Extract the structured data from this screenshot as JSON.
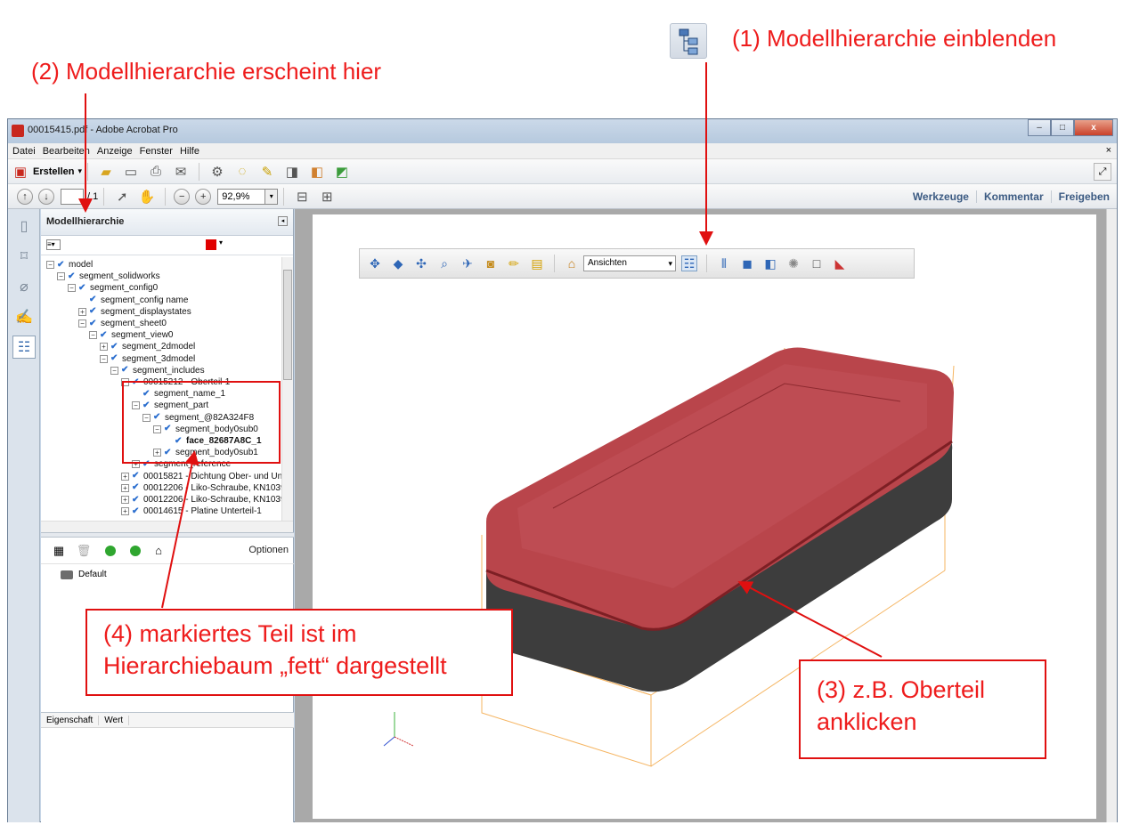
{
  "annotations": {
    "step1": "(1) Modellhierarchie einblenden",
    "step2": "(2) Modellhierarchie erscheint hier",
    "step3_line1": "(3) z.B. Oberteil",
    "step3_line2": "anklicken",
    "step4_line1": "(4) markiertes Teil ist im",
    "step4_line2": "Hierarchiebaum „fett“ dargestellt"
  },
  "window": {
    "title": "00015415.pdf - Adobe Acrobat Pro",
    "min": "–",
    "max": "□",
    "close": "x"
  },
  "menu": [
    "Datei",
    "Bearbeiten",
    "Anzeige",
    "Fenster",
    "Hilfe"
  ],
  "menu_close": "×",
  "toolbar": {
    "create_label": "Erstellen",
    "page_total": "/ 1",
    "zoom": "92,9%",
    "tools": "Werkzeuge",
    "comment": "Kommentar",
    "share": "Freigeben"
  },
  "panel": {
    "title": "Modellhierarchie",
    "color": "#e00000",
    "tree": [
      {
        "label": "model",
        "level": 0,
        "exp": "−",
        "bold": false
      },
      {
        "label": "segment_solidworks",
        "level": 1,
        "exp": "−",
        "bold": false
      },
      {
        "label": "segment_config0",
        "level": 2,
        "exp": "−",
        "bold": false
      },
      {
        "label": "segment_config name",
        "level": 3,
        "exp": "",
        "bold": false
      },
      {
        "label": "segment_displaystates",
        "level": 3,
        "exp": "+",
        "bold": false
      },
      {
        "label": "segment_sheet0",
        "level": 3,
        "exp": "−",
        "bold": false
      },
      {
        "label": "segment_view0",
        "level": 4,
        "exp": "−",
        "bold": false
      },
      {
        "label": "segment_2dmodel",
        "level": 5,
        "exp": "+",
        "bold": false
      },
      {
        "label": "segment_3dmodel",
        "level": 5,
        "exp": "−",
        "bold": false
      },
      {
        "label": "segment_includes",
        "level": 6,
        "exp": "−",
        "bold": false
      },
      {
        "label": "00015212 - Oberteil-1",
        "level": 7,
        "exp": "−",
        "bold": false
      },
      {
        "label": "segment_name_1",
        "level": 8,
        "exp": "",
        "bold": false
      },
      {
        "label": "segment_part",
        "level": 8,
        "exp": "−",
        "bold": false
      },
      {
        "label": "segment_@82A324F8",
        "level": 9,
        "exp": "−",
        "bold": false
      },
      {
        "label": "segment_body0sub0",
        "level": 10,
        "exp": "−",
        "bold": false
      },
      {
        "label": "face_82687A8C_1",
        "level": 11,
        "exp": "",
        "bold": true
      },
      {
        "label": "segment_body0sub1",
        "level": 10,
        "exp": "+",
        "bold": false
      },
      {
        "label": "segment_reference",
        "level": 8,
        "exp": "+",
        "bold": false
      },
      {
        "label": "00015821 - Dichtung Ober- und Un",
        "level": 7,
        "exp": "+",
        "bold": false
      },
      {
        "label": "00012206 - Liko-Schraube, KN1039",
        "level": 7,
        "exp": "+",
        "bold": false
      },
      {
        "label": "00012206 - Liko-Schraube, KN1039",
        "level": 7,
        "exp": "+",
        "bold": false
      },
      {
        "label": "00014615 - Platine Unterteil-1",
        "level": 7,
        "exp": "+",
        "bold": false
      }
    ],
    "options": "Optionen",
    "view_default": "Default",
    "props_cols": [
      "Eigenschaft",
      "Wert"
    ]
  },
  "toolbar3d": {
    "views_select": "Ansichten"
  },
  "colors": {
    "annotation": "#ee1c1c",
    "body_top": "#b8444a",
    "body_bottom": "#3b3b3b"
  }
}
